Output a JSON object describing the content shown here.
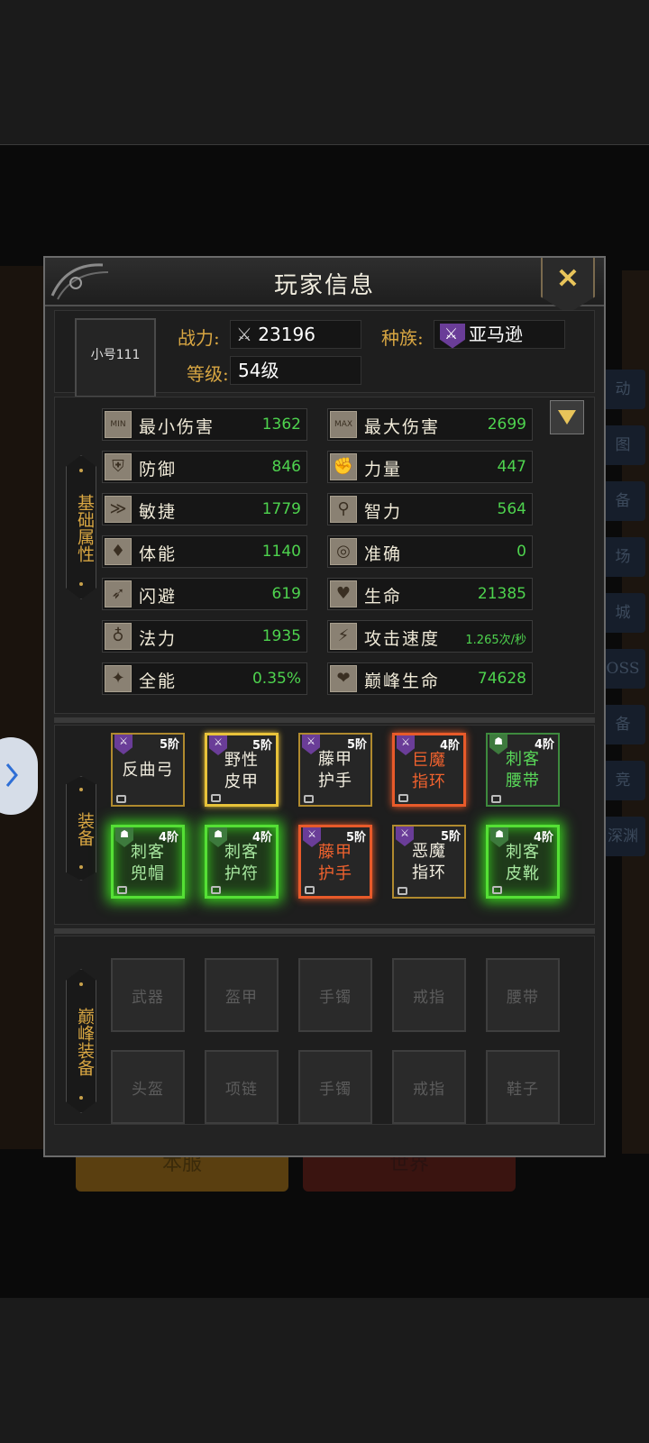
{
  "panel": {
    "title": "玩家信息",
    "close_label": "✕"
  },
  "profile": {
    "name": "小号111",
    "power_label": "战力:",
    "power_value": "23196",
    "race_label": "种族:",
    "race_value": "亚马逊",
    "level_label": "等级:",
    "level_value": "54级"
  },
  "basic_tab": {
    "label": "基础属性"
  },
  "stats": [
    {
      "icon": "min-damage-icon",
      "icon_text": "MIN",
      "name": "最小伤害",
      "value": "1362"
    },
    {
      "icon": "max-damage-icon",
      "icon_text": "MAX",
      "name": "最大伤害",
      "value": "2699"
    },
    {
      "icon": "shield-icon",
      "icon_text": "⛨",
      "name": "防御",
      "value": "846"
    },
    {
      "icon": "fist-icon",
      "icon_text": "✊",
      "name": "力量",
      "value": "447"
    },
    {
      "icon": "dash-icon",
      "icon_text": "≫",
      "name": "敏捷",
      "value": "1779"
    },
    {
      "icon": "staff-icon",
      "icon_text": "⚲",
      "name": "智力",
      "value": "564"
    },
    {
      "icon": "muscle-icon",
      "icon_text": "♦",
      "name": "体能",
      "value": "1140"
    },
    {
      "icon": "target-icon",
      "icon_text": "◎",
      "name": "准确",
      "value": "0"
    },
    {
      "icon": "dodge-icon",
      "icon_text": "➶",
      "name": "闪避",
      "value": "619"
    },
    {
      "icon": "heart-icon",
      "icon_text": "♥",
      "name": "生命",
      "value": "21385"
    },
    {
      "icon": "potion-icon",
      "icon_text": "♁",
      "name": "法力",
      "value": "1935"
    },
    {
      "icon": "attack-speed-icon",
      "icon_text": "⚡",
      "name": "攻击速度",
      "value": "1.265次/秒"
    },
    {
      "icon": "all-round-icon",
      "icon_text": "✦",
      "name": "全能",
      "value": "0.35%"
    },
    {
      "icon": "peak-life-icon",
      "icon_text": "❤",
      "name": "巅峰生命",
      "value": "74628"
    }
  ],
  "equip_tab": {
    "label": "装备"
  },
  "equipment": [
    {
      "name_line1": "反曲弓",
      "name_line2": "",
      "tier": "5阶",
      "type": "weapon",
      "quality": "gold"
    },
    {
      "name_line1": "野性",
      "name_line2": "皮甲",
      "tier": "5阶",
      "type": "weapon",
      "quality": "yellow"
    },
    {
      "name_line1": "藤甲",
      "name_line2": "护手",
      "tier": "5阶",
      "type": "weapon",
      "quality": "gold"
    },
    {
      "name_line1": "巨魔",
      "name_line2": "指环",
      "tier": "4阶",
      "type": "weapon",
      "quality": "orange"
    },
    {
      "name_line1": "刺客",
      "name_line2": "腰带",
      "tier": "4阶",
      "type": "helm",
      "quality": "green"
    },
    {
      "name_line1": "刺客",
      "name_line2": "兜帽",
      "tier": "4阶",
      "type": "helm",
      "quality": "glow"
    },
    {
      "name_line1": "刺客",
      "name_line2": "护符",
      "tier": "4阶",
      "type": "helm",
      "quality": "glow"
    },
    {
      "name_line1": "藤甲",
      "name_line2": "护手",
      "tier": "5阶",
      "type": "weapon",
      "quality": "orange"
    },
    {
      "name_line1": "恶魔",
      "name_line2": "指环",
      "tier": "5阶",
      "type": "weapon",
      "quality": "gold"
    },
    {
      "name_line1": "刺客",
      "name_line2": "皮靴",
      "tier": "4阶",
      "type": "helm",
      "quality": "glow"
    }
  ],
  "peak_tab": {
    "label": "巅峰装备"
  },
  "peak_slots": [
    "武器",
    "盔甲",
    "手镯",
    "戒指",
    "腰带",
    "头盔",
    "项链",
    "手镯",
    "戒指",
    "鞋子"
  ],
  "background": {
    "side_tabs": [
      "动",
      "图",
      "备",
      "场",
      "城",
      "OSS",
      "备",
      "竞",
      "深渊"
    ],
    "server_button": "本服",
    "world_button": "世界"
  }
}
